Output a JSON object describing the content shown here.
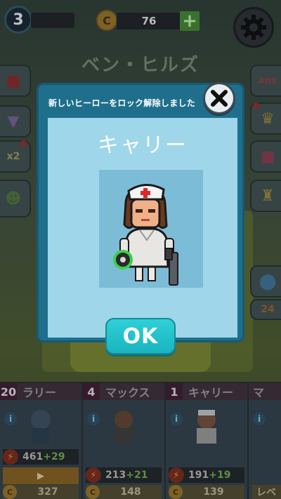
{
  "hud": {
    "level": "3",
    "coin_icon": "C",
    "coins": "76",
    "plus": "+"
  },
  "map_title": "ベン・ヒルズ",
  "side_left": [
    {
      "name": "gift-box-icon"
    },
    {
      "name": "shop-cart-icon"
    },
    {
      "name": "double-coin-icon",
      "label": "x2"
    },
    {
      "name": "zombie-badge-icon"
    }
  ],
  "side_right": [
    {
      "name": "no-ads-icon",
      "label": "ADS"
    },
    {
      "name": "crown-icon"
    },
    {
      "name": "gift-icon"
    },
    {
      "name": "trophy-icon"
    },
    {
      "name": "map-pin-icon"
    },
    {
      "name": "chat-icon",
      "label": "24"
    }
  ],
  "modal": {
    "title": "新しいヒーローをロック解除しました",
    "hero_name": "キャリー",
    "ok_label": "OK"
  },
  "hero_cards": [
    {
      "level": "20",
      "name": "ラリー",
      "power": "461",
      "bonus": "+29",
      "video": "▶",
      "price": "327"
    },
    {
      "level": "4",
      "name": "マックス",
      "power": "213",
      "bonus": "+21",
      "video": "",
      "price": "148"
    },
    {
      "level": "1",
      "name": "キャリー",
      "power": "191",
      "bonus": "+19",
      "video": "",
      "price": "139"
    },
    {
      "level": "",
      "name": "マ",
      "power": "",
      "bonus": "",
      "video": "",
      "price": "レベ"
    }
  ],
  "colors": {
    "modal_bg": "#1f6f8c",
    "panel_bg": "#9fd6e9",
    "ok_button": "#1ab4c0"
  }
}
